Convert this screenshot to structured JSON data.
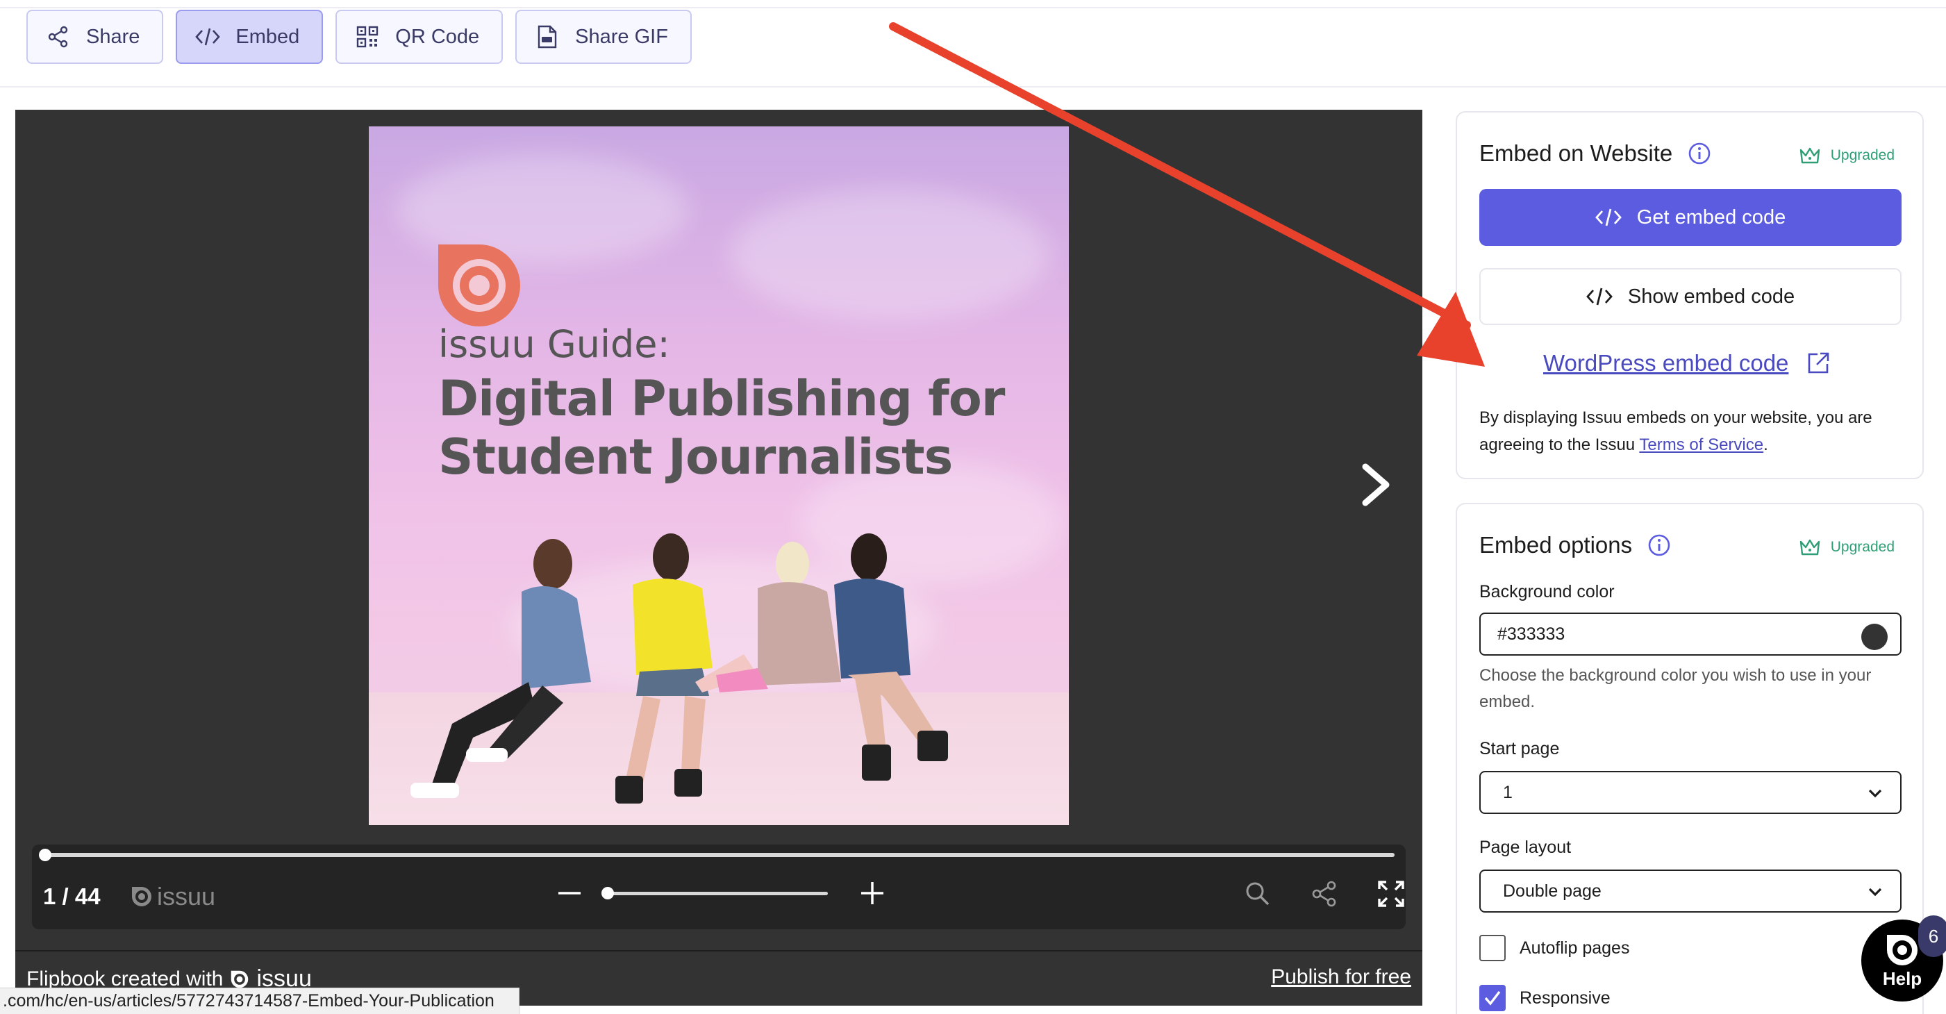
{
  "tabs": [
    {
      "label": "Share",
      "icon": "share-icon"
    },
    {
      "label": "Embed",
      "icon": "code-icon",
      "active": true
    },
    {
      "label": "QR Code",
      "icon": "qr-code-icon"
    },
    {
      "label": "Share GIF",
      "icon": "gif-file-icon"
    }
  ],
  "viewer": {
    "background_color": "#333333",
    "cover": {
      "brand_line": "issuu Guide:",
      "headline_line1": "Digital Publishing for",
      "headline_line2": "Student Journalists"
    },
    "page_indicator": "1 / 44",
    "brand": "issuu",
    "progress_fraction": 0.0,
    "zoom_fraction": 0.0,
    "footer": {
      "created_with": "Flipbook created with",
      "brand": "issuu",
      "publish_link": "Publish for free"
    }
  },
  "status_url": ".com/hc/en-us/articles/5772743714587-Embed-Your-Publication",
  "embed_website": {
    "title": "Embed on Website",
    "badge": "Upgraded",
    "get_code": "Get embed code",
    "show_code": "Show embed code",
    "wordpress_link": "WordPress embed code",
    "disclaimer_text": "By displaying Issuu embeds on your website, you are agreeing to the Issuu",
    "terms_link": "Terms of Service",
    "disclaimer_end": "."
  },
  "embed_options": {
    "title": "Embed options",
    "badge": "Upgraded",
    "background_color_label": "Background color",
    "background_color_value": "#333333",
    "background_color_help": "Choose the background color you wish to use in your embed.",
    "start_page_label": "Start page",
    "start_page_value": "1",
    "page_layout_label": "Page layout",
    "page_layout_value": "Double page",
    "autoflip_label": "Autoflip pages",
    "autoflip_checked": false,
    "responsive_label": "Responsive",
    "responsive_checked": true
  },
  "help": {
    "label": "Help",
    "badge": "6"
  },
  "colors": {
    "accent": "#5c5ce0",
    "upgraded": "#2f9e74",
    "annotation_arrow": "#e8412c"
  }
}
